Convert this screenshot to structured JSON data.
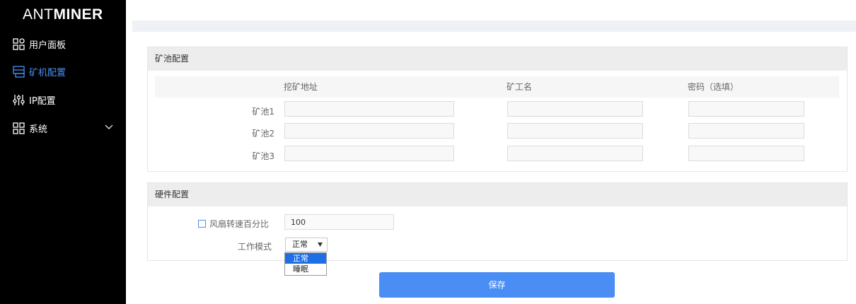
{
  "brand": {
    "prefix": "ANT",
    "suffix": "MINER"
  },
  "sidebar": {
    "items": [
      {
        "label": "用户面板",
        "icon": "dashboard-icon"
      },
      {
        "label": "矿机配置",
        "icon": "miner-config-icon",
        "active": true
      },
      {
        "label": "IP配置",
        "icon": "sliders-icon"
      },
      {
        "label": "系统",
        "icon": "system-icon",
        "expandable": true
      }
    ],
    "active_color": "#4a8ef5"
  },
  "pool_config": {
    "title": "矿池配置",
    "columns": [
      "挖矿地址",
      "矿工名",
      "密码（选填）"
    ],
    "rows": [
      {
        "label": "矿池1",
        "address": "",
        "worker": "",
        "password": ""
      },
      {
        "label": "矿池2",
        "address": "",
        "worker": "",
        "password": ""
      },
      {
        "label": "矿池3",
        "address": "",
        "worker": "",
        "password": ""
      }
    ]
  },
  "hardware_config": {
    "title": "硬件配置",
    "fan_label": "风扇转速百分比",
    "fan_checked": false,
    "fan_value": "100",
    "mode_label": "工作模式",
    "mode_selected": "正常",
    "mode_options": [
      "正常",
      "睡眠"
    ]
  },
  "save_label": "保存",
  "colors": {
    "accent": "#4a8ef5",
    "sidebar_bg": "#000000",
    "option_highlight": "#1e6fe6"
  }
}
